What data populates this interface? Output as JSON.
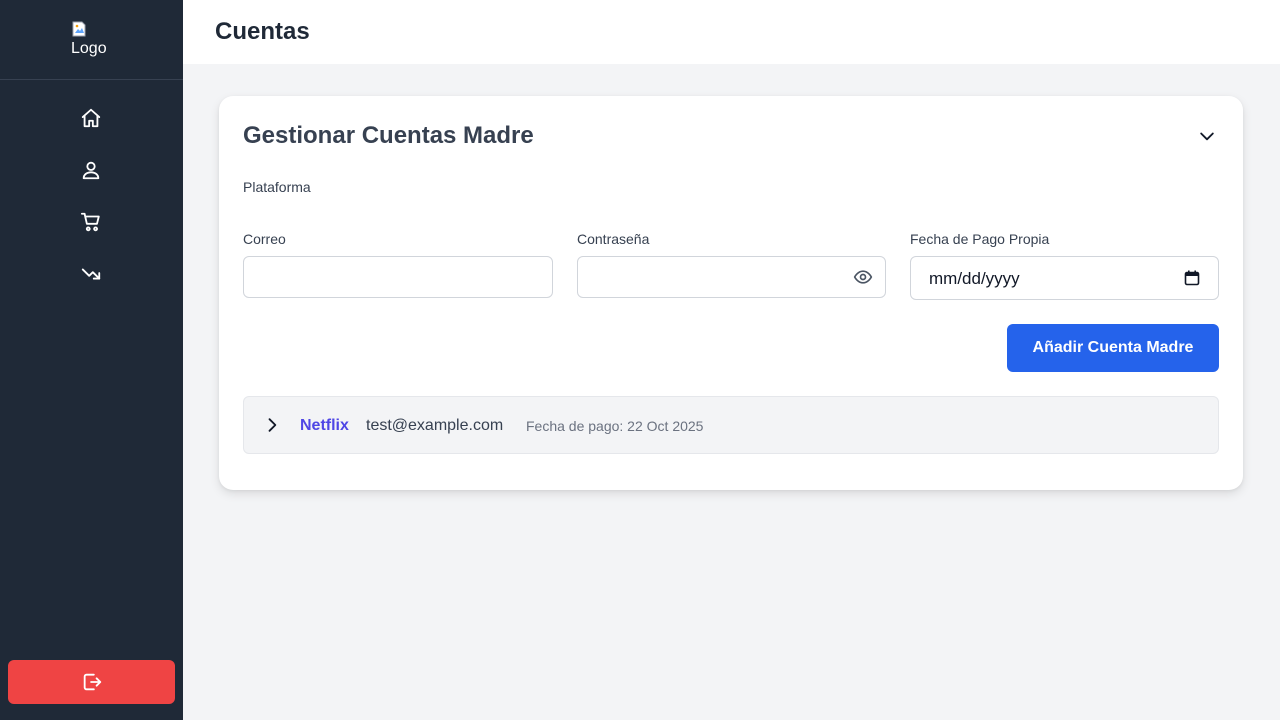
{
  "sidebar": {
    "logo_alt": "Logo",
    "nav_items": [
      {
        "icon": "home-icon",
        "label": ""
      },
      {
        "icon": "user-icon",
        "label": ""
      },
      {
        "icon": "cart-icon",
        "label": ""
      },
      {
        "icon": "trending-down-icon",
        "label": ""
      }
    ],
    "logout_icon": "logout-icon"
  },
  "header": {
    "title": "Cuentas"
  },
  "card": {
    "title": "Gestionar Cuentas Madre",
    "form": {
      "platform_label": "Plataforma",
      "email_label": "Correo",
      "email_value": "",
      "password_label": "Contraseña",
      "password_value": "",
      "date_label": "Fecha de Pago Propia",
      "date_placeholder": "mm/dd/yyyy",
      "submit_label": "Añadir Cuenta Madre"
    },
    "accounts": [
      {
        "platform": "Netflix",
        "email": "test@example.com",
        "payment_date": "Fecha de pago: 22 Oct 2025"
      }
    ]
  },
  "colors": {
    "sidebar_bg": "#1f2937",
    "accent": "#2563eb",
    "danger": "#ef4444",
    "platform": "#4f46e5"
  }
}
